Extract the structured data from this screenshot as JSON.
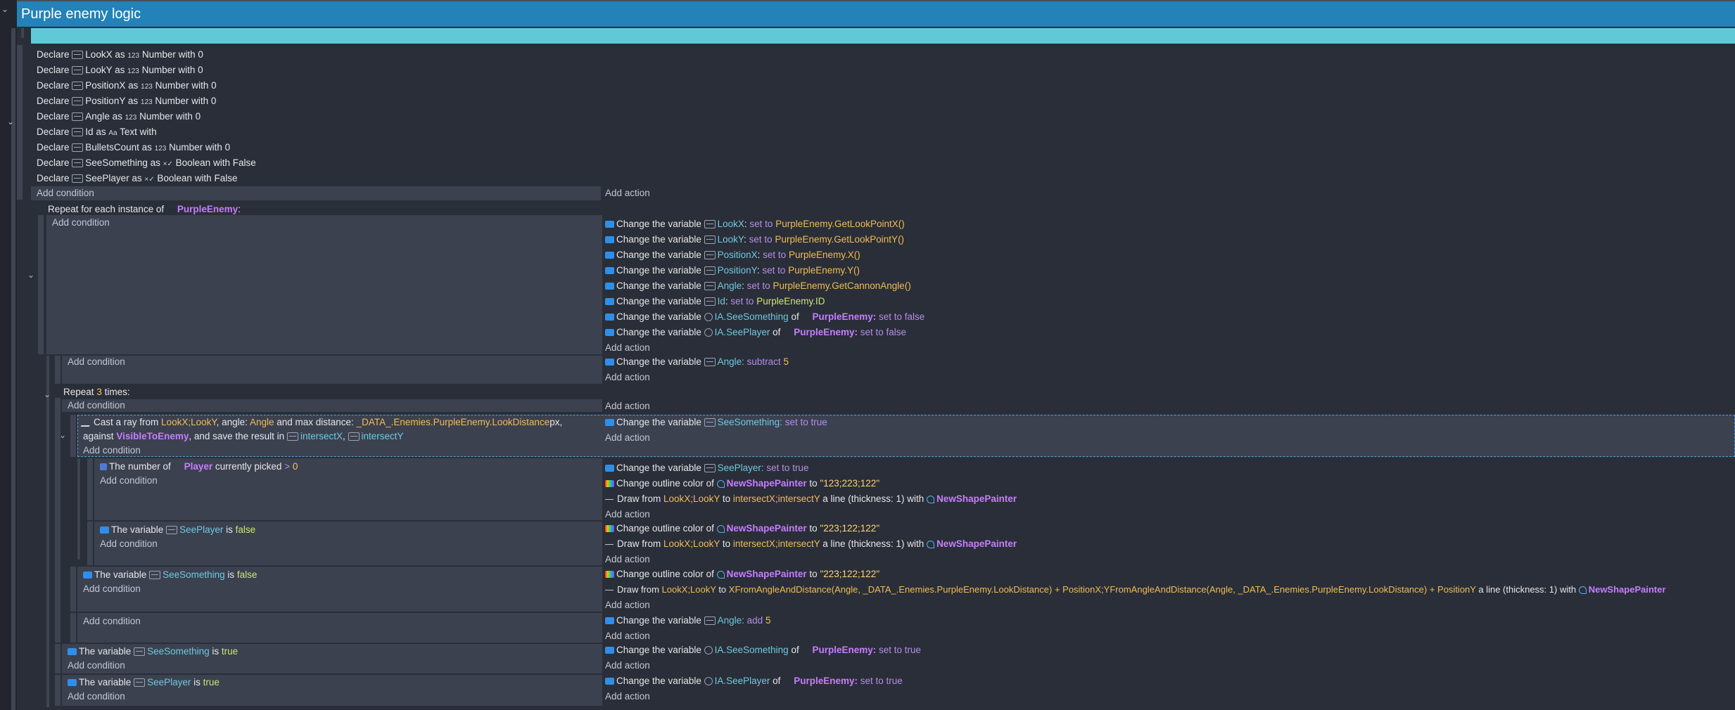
{
  "group": {
    "title": "Purple enemy logic"
  },
  "common": {
    "add_condition": "Add condition",
    "add_action": "Add action",
    "change_var": "Change the variable",
    "declare": "Declare",
    "as": "as",
    "with": "with"
  },
  "declares": [
    {
      "name": "LookX",
      "type_icon": "123",
      "type": "Number",
      "value": "0"
    },
    {
      "name": "LookY",
      "type_icon": "123",
      "type": "Number",
      "value": "0"
    },
    {
      "name": "PositionX",
      "type_icon": "123",
      "type": "Number",
      "value": "0"
    },
    {
      "name": "PositionY",
      "type_icon": "123",
      "type": "Number",
      "value": "0"
    },
    {
      "name": "Angle",
      "type_icon": "123",
      "type": "Number",
      "value": "0"
    },
    {
      "name": "Id",
      "type_icon": "Aa",
      "type": "Text",
      "value": ""
    },
    {
      "name": "BulletsCount",
      "type_icon": "123",
      "type": "Number",
      "value": "0"
    },
    {
      "name": "SeeSomething",
      "type_icon": "×✓",
      "type": "Boolean",
      "value": "False"
    },
    {
      "name": "SeePlayer",
      "type_icon": "×✓",
      "type": "Boolean",
      "value": "False"
    }
  ],
  "foreach": {
    "prefix": "Repeat for each instance of",
    "object": "PurpleEnemy",
    "suffix": ":"
  },
  "foreach_actions": [
    {
      "var": "LookX",
      "op": "set to",
      "value": "PurpleEnemy.GetLookPointX()"
    },
    {
      "var": "LookY",
      "op": "set to",
      "value": "PurpleEnemy.GetLookPointY()"
    },
    {
      "var": "PositionX",
      "op": "set to",
      "value": "PurpleEnemy.X()"
    },
    {
      "var": "PositionY",
      "op": "set to",
      "value": "PurpleEnemy.Y()"
    },
    {
      "var": "Angle",
      "op": "set to",
      "value": "PurpleEnemy.GetCannonAngle()"
    },
    {
      "var": "Id",
      "op": "set to",
      "value": "PurpleEnemy.ID"
    }
  ],
  "foreach_obj_actions": [
    {
      "var": "IA.SeeSomething",
      "of": "of",
      "object": "PurpleEnemy:",
      "op": "set to false"
    },
    {
      "var": "IA.SeePlayer",
      "of": "of",
      "object": "PurpleEnemy:",
      "op": "set to false"
    }
  ],
  "angle_sub": {
    "var": "Angle:",
    "op": "subtract",
    "value": "5"
  },
  "repeat": {
    "prefix": "Repeat",
    "count": "3",
    "suffix": "times:"
  },
  "raycast": {
    "l1_a": "Cast a ray from",
    "l1_from": "LookX;LookY",
    "l1_b": ", angle:",
    "l1_angle": "Angle",
    "l1_c": "and max distance:",
    "l1_dist": "_DATA_.Enemies.PurpleEnemy.LookDistance",
    "l1_d": "px,",
    "l2_a": "against",
    "l2_obj": "VisibleToEnemy",
    "l2_b": ", and save the result in",
    "l2_v1": "intersectX",
    "l2_sep": ",",
    "l2_v2": "intersectY"
  },
  "raycast_action": {
    "var": "SeeSomething:",
    "op": "set to true"
  },
  "player_cond": {
    "a": "The number of",
    "obj": "Player",
    "b": "currently picked",
    "op": ">",
    "num": "0"
  },
  "player_actions": {
    "a1_var": "SeePlayer:",
    "a1_op": "set to true",
    "a2_a": "Change outline color of",
    "a2_obj": "NewShapePainter",
    "a2_b": "to",
    "a2_val": "\"123;223;122\"",
    "a3_a": "Draw from",
    "a3_from": "LookX;LookY",
    "a3_b": "to",
    "a3_to": "intersectX;intersectY",
    "a3_c": "a line (thickness: 1) with",
    "a3_obj": "NewShapePainter"
  },
  "seeplayer_false": {
    "a": "The variable",
    "var": "SeePlayer",
    "b": "is",
    "val": "false",
    "a1_a": "Change outline color of",
    "a1_obj": "NewShapePainter",
    "a1_b": "to",
    "a1_val": "\"223;122;122\"",
    "a2_a": "Draw from",
    "a2_from": "LookX;LookY",
    "a2_b": "to",
    "a2_to": "intersectX;intersectY",
    "a2_c": "a line (thickness: 1) with",
    "a2_obj": "NewShapePainter"
  },
  "seesomething_false": {
    "a": "The variable",
    "var": "SeeSomething",
    "b": "is",
    "val": "false",
    "a1_a": "Change outline color of",
    "a1_obj": "NewShapePainter",
    "a1_b": "to",
    "a1_val": "\"223;122;122\"",
    "a2_a": "Draw from",
    "a2_from": "LookX;LookY",
    "a2_b": "to",
    "a2_to": "XFromAngleAndDistance(Angle, _DATA_.Enemies.PurpleEnemy.LookDistance) + PositionX;YFromAngleAndDistance(Angle, _DATA_.Enemies.PurpleEnemy.LookDistance) + PositionY",
    "a2_c": "a line (thickness: 1) with",
    "a2_obj": "NewShapePainter"
  },
  "angle_add": {
    "var": "Angle:",
    "op": "add",
    "value": "5"
  },
  "seesomething_true": {
    "a": "The variable",
    "var": "SeeSomething",
    "b": "is",
    "val": "true",
    "act_var": "IA.SeeSomething",
    "act_of": "of",
    "act_obj": "PurpleEnemy:",
    "act_op": "set to true"
  },
  "seeplayer_true": {
    "a": "The variable",
    "var": "SeePlayer",
    "b": "is",
    "val": "true",
    "act_var": "IA.SeePlayer",
    "act_of": "of",
    "act_obj": "PurpleEnemy:",
    "act_op": "set to true"
  }
}
